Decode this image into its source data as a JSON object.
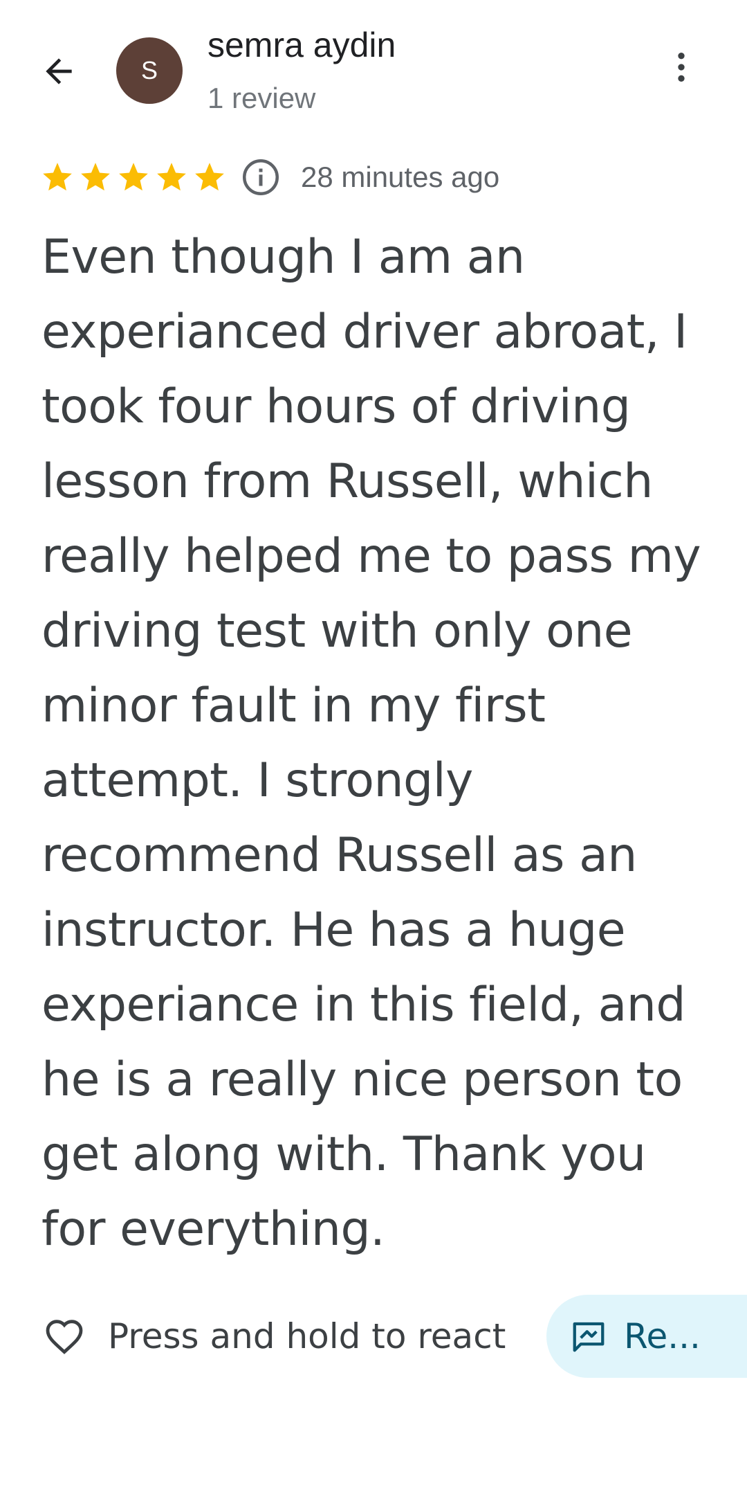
{
  "header": {
    "back_icon": "arrow-back-icon",
    "avatar_initial": "S",
    "avatar_color": "#5d4037",
    "reviewer_name": "semra aydin",
    "review_count": "1 review",
    "more_icon": "more-vert-icon"
  },
  "review": {
    "rating": 5,
    "rating_max": 5,
    "star_color": "#fbbc04",
    "info_icon": "info-icon",
    "timestamp": "28 minutes ago",
    "text": "Even though I am an experianced driver abroat, I took four hours of driving lesson from Russell, which really helped me to pass my driving test with only one minor fault in my first attempt. I strongly recommend Russell as an instructor. He has a huge experiance in this field, and he is a really nice person to get along with. Thank you for everything."
  },
  "actions": {
    "react_icon": "heart-outline-icon",
    "react_label": "Press and hold to react",
    "reply_icon": "reply-icon",
    "reply_label": "Re...",
    "reply_bg_color": "#e0f5fb"
  }
}
